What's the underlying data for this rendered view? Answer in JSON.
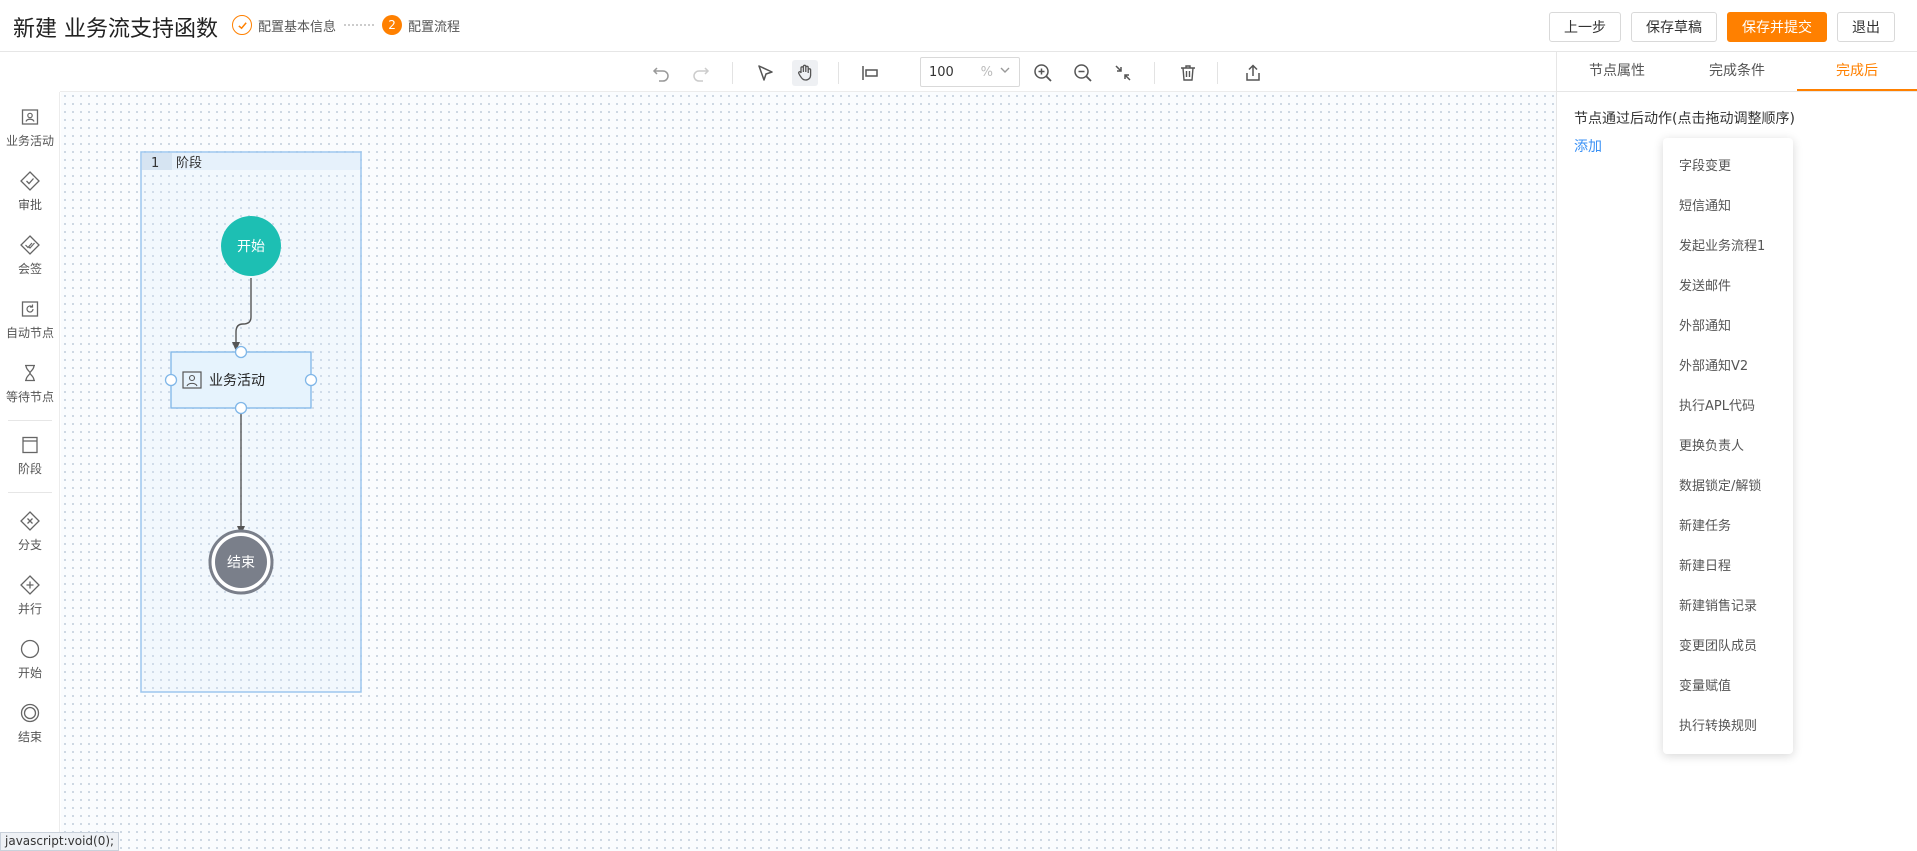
{
  "header": {
    "title": "新建 业务流支持函数",
    "step1_label": "配置基本信息",
    "step2_num": "2",
    "step2_label": "配置流程",
    "buttons": {
      "prev": "上一步",
      "save_draft": "保存草稿",
      "save_submit": "保存并提交",
      "exit": "退出"
    }
  },
  "toolbar": {
    "zoom_value": "100",
    "zoom_unit": "%"
  },
  "left_tools": [
    "业务活动",
    "审批",
    "会签",
    "自动节点",
    "等待节点",
    "阶段",
    "分支",
    "并行",
    "开始",
    "结束"
  ],
  "canvas": {
    "stage_index": "1",
    "stage_label": "阶段",
    "start_label": "开始",
    "activity_label": "业务活动",
    "end_label": "结束"
  },
  "right_panel": {
    "tabs": [
      "节点属性",
      "完成条件",
      "完成后"
    ],
    "description": "节点通过后动作(点击拖动调整顺序)",
    "add_label": "添加",
    "dropdown_items": [
      "字段变更",
      "短信通知",
      "发起业务流程1",
      "发送邮件",
      "外部通知",
      "外部通知V2",
      "执行APL代码",
      "更换负责人",
      "数据锁定/解锁",
      "新建任务",
      "新建日程",
      "新建销售记录",
      "变更团队成员",
      "变量赋值",
      "执行转换规则"
    ]
  },
  "status_bar": "javascript:void(0);",
  "colors": {
    "accent": "#ff8000",
    "start_node": "#1dbfb3",
    "end_node": "#7a7f8a",
    "link": "#3b91f5"
  }
}
